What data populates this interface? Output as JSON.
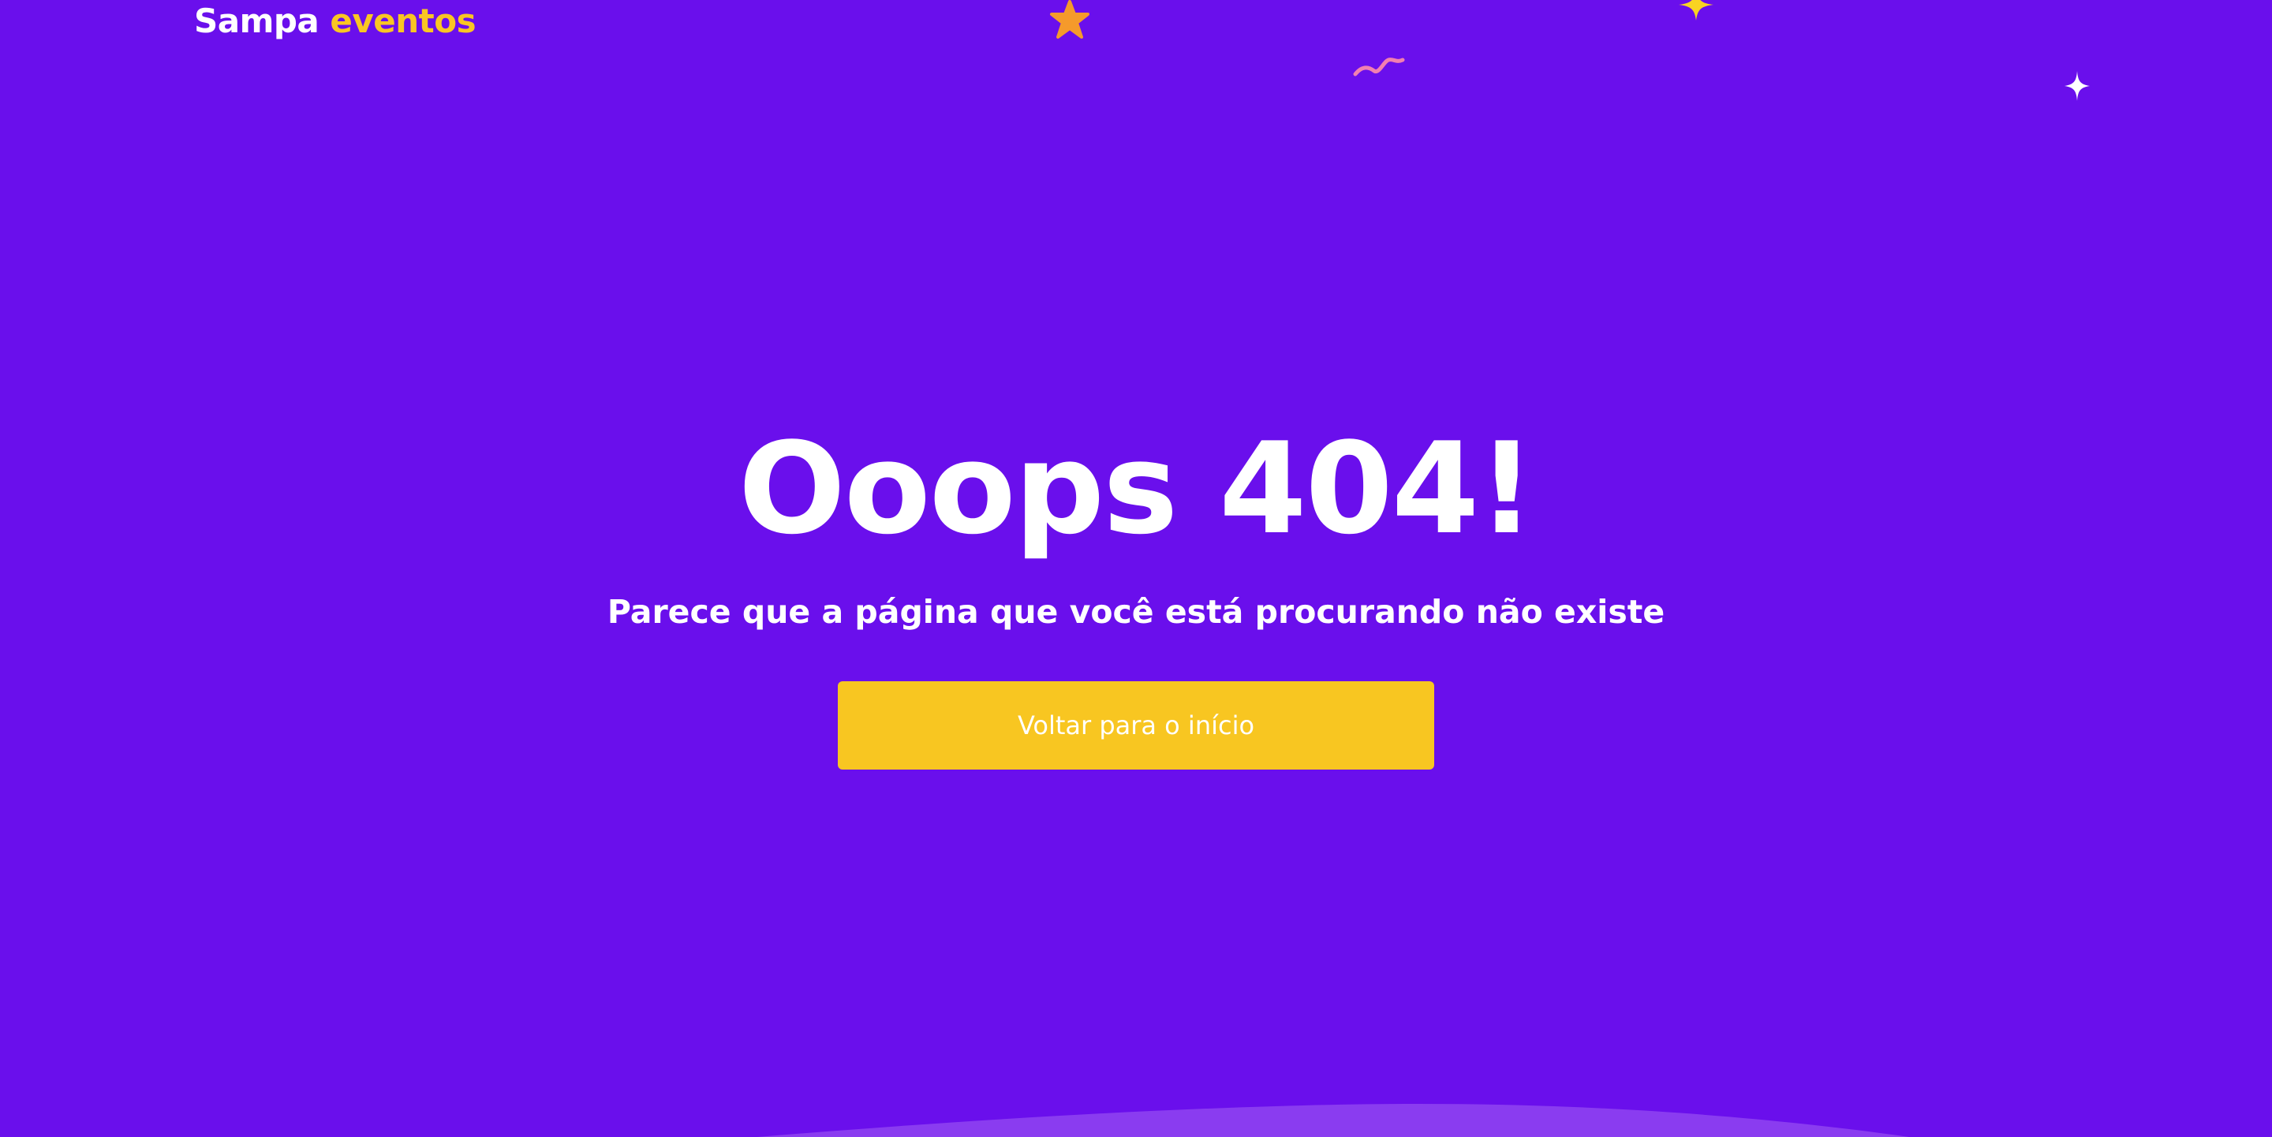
{
  "header": {
    "logo_primary": "Sampa",
    "logo_accent": "eventos"
  },
  "main": {
    "title": "Ooops 404!",
    "subtitle": "Parece que a página que você está procurando não existe",
    "cta_label": "Voltar para o início"
  },
  "decorations": [
    {
      "name": "orange-star-icon",
      "color": "#f59a2b"
    },
    {
      "name": "pink-squiggle-icon",
      "color": "#f27fb0"
    },
    {
      "name": "yellow-sparkle-icon",
      "color": "#f9d322"
    },
    {
      "name": "white-sparkle-icon",
      "color": "#ffffff"
    }
  ],
  "colors": {
    "background": "#6a0fec",
    "accent": "#f9c623",
    "button": "#f8c621",
    "wave": "#8a3cf0"
  }
}
